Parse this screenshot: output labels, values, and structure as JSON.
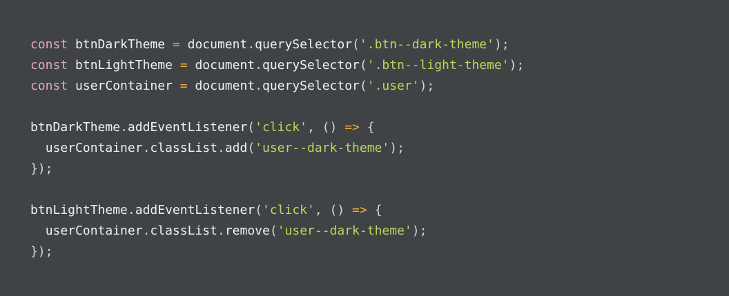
{
  "code": {
    "language": "javascript",
    "lines": [
      [
        {
          "t": "const",
          "k": "keyword"
        },
        {
          "t": " ",
          "k": "space"
        },
        {
          "t": "btnDarkTheme",
          "k": "ident"
        },
        {
          "t": " ",
          "k": "space"
        },
        {
          "t": "=",
          "k": "op"
        },
        {
          "t": " ",
          "k": "space"
        },
        {
          "t": "document",
          "k": "ident"
        },
        {
          "t": ".",
          "k": "punct"
        },
        {
          "t": "querySelector",
          "k": "prop"
        },
        {
          "t": "(",
          "k": "punct"
        },
        {
          "t": "'.btn--dark-theme'",
          "k": "string"
        },
        {
          "t": ");",
          "k": "punct"
        }
      ],
      [
        {
          "t": "const",
          "k": "keyword"
        },
        {
          "t": " ",
          "k": "space"
        },
        {
          "t": "btnLightTheme",
          "k": "ident"
        },
        {
          "t": " ",
          "k": "space"
        },
        {
          "t": "=",
          "k": "op"
        },
        {
          "t": " ",
          "k": "space"
        },
        {
          "t": "document",
          "k": "ident"
        },
        {
          "t": ".",
          "k": "punct"
        },
        {
          "t": "querySelector",
          "k": "prop"
        },
        {
          "t": "(",
          "k": "punct"
        },
        {
          "t": "'.btn--light-theme'",
          "k": "string"
        },
        {
          "t": ");",
          "k": "punct"
        }
      ],
      [
        {
          "t": "const",
          "k": "keyword"
        },
        {
          "t": " ",
          "k": "space"
        },
        {
          "t": "userContainer",
          "k": "ident"
        },
        {
          "t": " ",
          "k": "space"
        },
        {
          "t": "=",
          "k": "op"
        },
        {
          "t": " ",
          "k": "space"
        },
        {
          "t": "document",
          "k": "ident"
        },
        {
          "t": ".",
          "k": "punct"
        },
        {
          "t": "querySelector",
          "k": "prop"
        },
        {
          "t": "(",
          "k": "punct"
        },
        {
          "t": "'.user'",
          "k": "string"
        },
        {
          "t": ");",
          "k": "punct"
        }
      ],
      [],
      [
        {
          "t": "btnDarkTheme",
          "k": "ident"
        },
        {
          "t": ".",
          "k": "punct"
        },
        {
          "t": "addEventListener",
          "k": "prop"
        },
        {
          "t": "(",
          "k": "punct"
        },
        {
          "t": "'click'",
          "k": "string"
        },
        {
          "t": ", ",
          "k": "punct"
        },
        {
          "t": "()",
          "k": "punct"
        },
        {
          "t": " ",
          "k": "space"
        },
        {
          "t": "=>",
          "k": "op"
        },
        {
          "t": " ",
          "k": "space"
        },
        {
          "t": "{",
          "k": "punct"
        }
      ],
      [
        {
          "t": "  ",
          "k": "space"
        },
        {
          "t": "userContainer",
          "k": "ident"
        },
        {
          "t": ".",
          "k": "punct"
        },
        {
          "t": "classList",
          "k": "prop"
        },
        {
          "t": ".",
          "k": "punct"
        },
        {
          "t": "add",
          "k": "prop"
        },
        {
          "t": "(",
          "k": "punct"
        },
        {
          "t": "'user--dark-theme'",
          "k": "string"
        },
        {
          "t": ");",
          "k": "punct"
        }
      ],
      [
        {
          "t": "});",
          "k": "punct"
        }
      ],
      [],
      [
        {
          "t": "btnLightTheme",
          "k": "ident"
        },
        {
          "t": ".",
          "k": "punct"
        },
        {
          "t": "addEventListener",
          "k": "prop"
        },
        {
          "t": "(",
          "k": "punct"
        },
        {
          "t": "'click'",
          "k": "string"
        },
        {
          "t": ", ",
          "k": "punct"
        },
        {
          "t": "()",
          "k": "punct"
        },
        {
          "t": " ",
          "k": "space"
        },
        {
          "t": "=>",
          "k": "op"
        },
        {
          "t": " ",
          "k": "space"
        },
        {
          "t": "{",
          "k": "punct"
        }
      ],
      [
        {
          "t": "  ",
          "k": "space"
        },
        {
          "t": "userContainer",
          "k": "ident"
        },
        {
          "t": ".",
          "k": "punct"
        },
        {
          "t": "classList",
          "k": "prop"
        },
        {
          "t": ".",
          "k": "punct"
        },
        {
          "t": "remove",
          "k": "prop"
        },
        {
          "t": "(",
          "k": "punct"
        },
        {
          "t": "'user--dark-theme'",
          "k": "string"
        },
        {
          "t": ");",
          "k": "punct"
        }
      ],
      [
        {
          "t": "});",
          "k": "punct"
        }
      ]
    ]
  },
  "colors": {
    "background": "#3f4346",
    "keyword": "#e6a9b4",
    "string": "#b8d95e",
    "operator": "#f2a83a",
    "text": "#f0f0f0"
  }
}
